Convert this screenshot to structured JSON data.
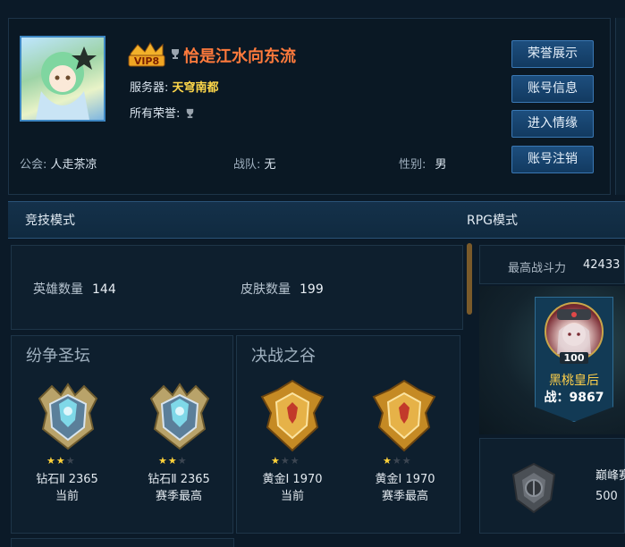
{
  "profile": {
    "vip_label": "VIP8",
    "player_name": "恰是江水向东流",
    "server_label": "服务器:",
    "server_value": "天穹南都",
    "honors_label": "所有荣誉:",
    "guild_label": "公会:",
    "guild_value": "人走茶凉",
    "team_label": "战队:",
    "team_value": "无",
    "gender_label": "性别:",
    "gender_value": "男"
  },
  "buttons": {
    "honor_display": "荣誉展示",
    "account_info": "账号信息",
    "relationship": "进入情缘",
    "account_cancel": "账号注销"
  },
  "modes": {
    "competitive": "竞技模式",
    "rpg": "RPG模式"
  },
  "stats": {
    "heroes_label": "英雄数量",
    "heroes_value": "144",
    "skins_label": "皮肤数量",
    "skins_value": "199"
  },
  "ranks": {
    "left_title": "纷争圣坛",
    "right_title": "决战之谷",
    "items": [
      {
        "tier": "钻石Ⅱ 2365",
        "caption": "当前",
        "stars": 2
      },
      {
        "tier": "钻石Ⅱ 2365",
        "caption": "赛季最高",
        "stars": 2
      },
      {
        "tier": "黄金Ⅰ 1970",
        "caption": "当前",
        "stars": 1
      },
      {
        "tier": "黄金Ⅰ 1970",
        "caption": "赛季最高",
        "stars": 1
      }
    ]
  },
  "rpg": {
    "power_label": "最高战斗力",
    "power_value": "42433",
    "hero_level": "100",
    "hero_name": "黑桃皇后",
    "hero_power": "战：9867",
    "peak_label": "巅峰赛",
    "peak_value": "500"
  },
  "colors": {
    "accent": "#3a78b4",
    "name": "#ff7a3c",
    "gold": "#ffd84a"
  }
}
